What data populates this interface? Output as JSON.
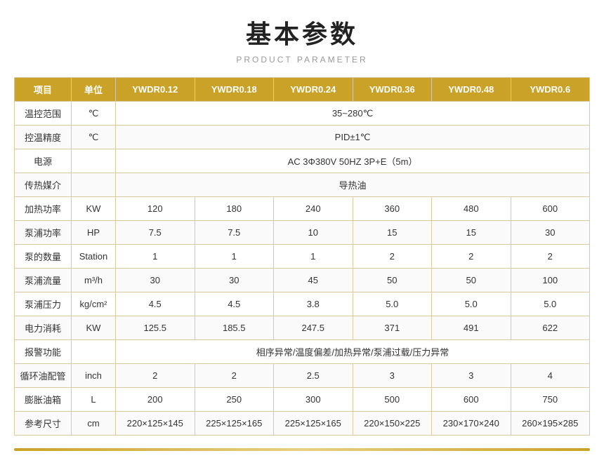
{
  "title": "基本参数",
  "subtitle": "PRODUCT PARAMETER",
  "table": {
    "headers": [
      "项目",
      "单位",
      "YWDR0.12",
      "YWDR0.18",
      "YWDR0.24",
      "YWDR0.36",
      "YWDR0.48",
      "YWDR0.6"
    ],
    "rows": [
      {
        "item": "温控范围",
        "unit": "℃",
        "merged": true,
        "value": "35~280℃"
      },
      {
        "item": "控温精度",
        "unit": "℃",
        "merged": true,
        "value": "PID±1℃"
      },
      {
        "item": "电源",
        "unit": "",
        "merged": true,
        "value": "AC 3Φ380V 50HZ 3P+E（5m）"
      },
      {
        "item": "传热媒介",
        "unit": "",
        "merged": true,
        "value": "导热油"
      },
      {
        "item": "加热功率",
        "unit": "KW",
        "merged": false,
        "values": [
          "120",
          "180",
          "240",
          "360",
          "480",
          "600"
        ]
      },
      {
        "item": "泵浦功率",
        "unit": "HP",
        "merged": false,
        "values": [
          "7.5",
          "7.5",
          "10",
          "15",
          "15",
          "30"
        ]
      },
      {
        "item": "泵的数量",
        "unit": "Station",
        "merged": false,
        "values": [
          "1",
          "1",
          "1",
          "2",
          "2",
          "2"
        ]
      },
      {
        "item": "泵浦流量",
        "unit": "m³/h",
        "merged": false,
        "values": [
          "30",
          "30",
          "45",
          "50",
          "50",
          "100"
        ]
      },
      {
        "item": "泵浦压力",
        "unit": "kg/cm²",
        "merged": false,
        "values": [
          "4.5",
          "4.5",
          "3.8",
          "5.0",
          "5.0",
          "5.0"
        ]
      },
      {
        "item": "电力消耗",
        "unit": "KW",
        "merged": false,
        "values": [
          "125.5",
          "185.5",
          "247.5",
          "371",
          "491",
          "622"
        ]
      },
      {
        "item": "报警功能",
        "unit": "",
        "merged": true,
        "value": "相序异常/温度偏差/加热异常/泵浦过载/压力异常"
      },
      {
        "item": "循环油配管",
        "unit": "inch",
        "merged": false,
        "values": [
          "2",
          "2",
          "2.5",
          "3",
          "3",
          "4"
        ]
      },
      {
        "item": "膨胀油箱",
        "unit": "L",
        "merged": false,
        "values": [
          "200",
          "250",
          "300",
          "500",
          "600",
          "750"
        ]
      },
      {
        "item": "参考尺寸",
        "unit": "cm",
        "merged": false,
        "values": [
          "220×125×145",
          "225×125×165",
          "225×125×165",
          "220×150×225",
          "230×170×240",
          "260×195×285"
        ]
      }
    ]
  }
}
